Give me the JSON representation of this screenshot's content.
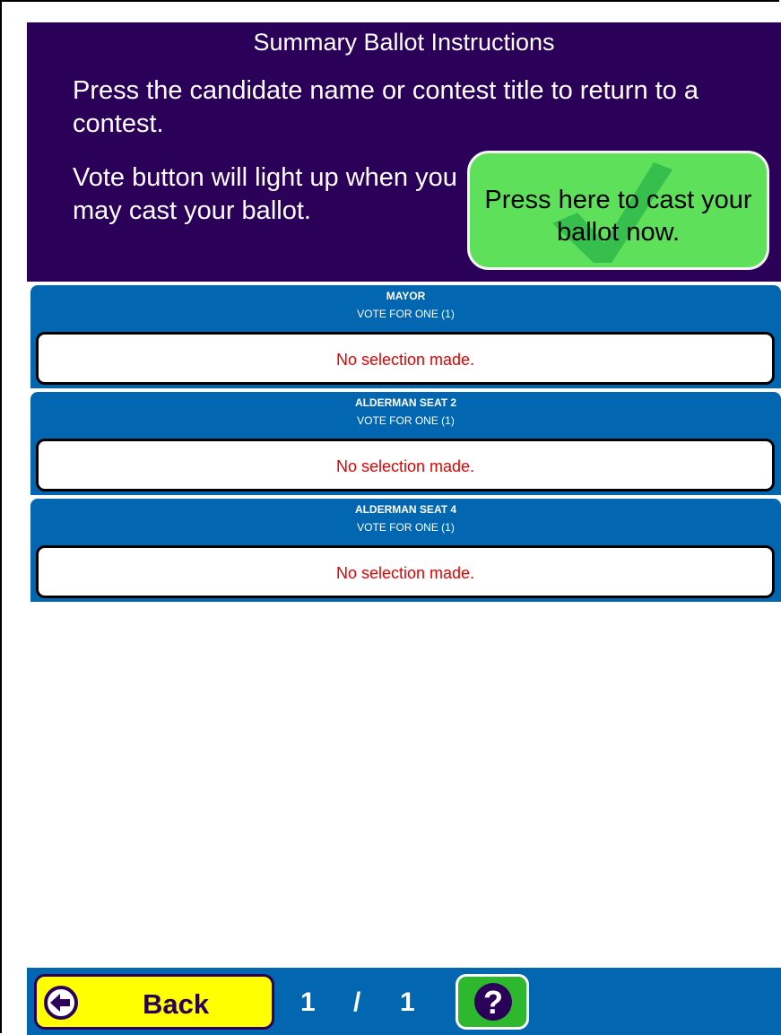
{
  "header": {
    "title": "Summary Ballot Instructions",
    "instruction_1": "Press the candidate name or contest title to return to a contest.",
    "instruction_2": "Vote button will light up when you may cast your ballot.",
    "cast_button_label": "Press here to cast your ballot now."
  },
  "contests": [
    {
      "title": "MAYOR",
      "vote_for": "VOTE FOR ONE (1)",
      "selection": "No selection made."
    },
    {
      "title": "ALDERMAN SEAT 2",
      "vote_for": "VOTE FOR ONE (1)",
      "selection": "No selection made."
    },
    {
      "title": "ALDERMAN SEAT 4",
      "vote_for": "VOTE FOR ONE (1)",
      "selection": "No selection made."
    }
  ],
  "footer": {
    "back_label": "Back",
    "current_page": "1",
    "separator": "/",
    "total_pages": "1"
  },
  "icons": {
    "cast": "checkmark-icon",
    "back": "back-arrow-icon",
    "help": "question-mark-icon"
  },
  "colors": {
    "header_bg": "#2b0058",
    "contest_bg": "#0266b0",
    "cast_button_bg": "#5ee05a",
    "back_button_bg": "#ffff00",
    "help_button_bg": "#2eb82e",
    "no_selection_text": "#e60000"
  }
}
